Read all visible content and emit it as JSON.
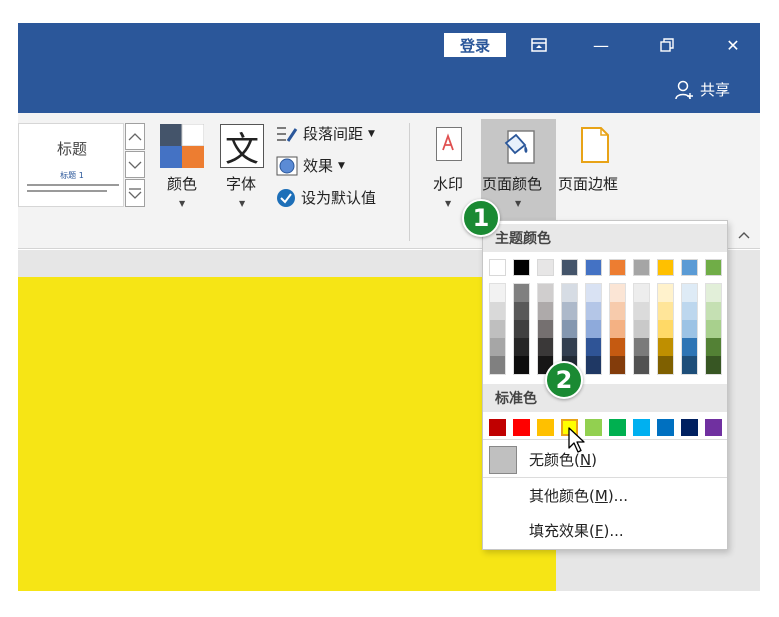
{
  "titlebar": {
    "login_label": "登录",
    "ribbon_display_icon": "ribbon-display-icon",
    "minimize_glyph": "—",
    "restore_glyph": "⧉",
    "close_glyph": "✕",
    "share_label": "共享",
    "bg_color": "#2b579a"
  },
  "ribbon": {
    "gallery": {
      "title": "标题",
      "subtitle": "标题 1"
    },
    "colors_label": "颜色",
    "font_label": "字体",
    "font_glyph": "文",
    "paragraph_spacing_label": "段落间距",
    "effects_label": "效果",
    "set_default_label": "设为默认值",
    "watermark_label": "水印",
    "page_color_label": "页面颜色",
    "page_borders_label": "页面边框",
    "collapse_glyph": "^"
  },
  "document": {
    "page_color": "#f6e515"
  },
  "page_color_menu": {
    "theme_colors_header": "主题颜色",
    "theme_base": [
      "#ffffff",
      "#000000",
      "#e7e6e6",
      "#44546a",
      "#4472c4",
      "#ed7d31",
      "#a5a5a5",
      "#ffc000",
      "#5b9bd5",
      "#70ad47"
    ],
    "theme_shades": [
      [
        "#f2f2f2",
        "#d9d9d9",
        "#bfbfbf",
        "#a6a6a6",
        "#808080"
      ],
      [
        "#808080",
        "#595959",
        "#404040",
        "#262626",
        "#0d0d0d"
      ],
      [
        "#d0cece",
        "#aeaaaa",
        "#757070",
        "#3a3838",
        "#171616"
      ],
      [
        "#d6dce4",
        "#adb9ca",
        "#8497b0",
        "#333f50",
        "#222a35"
      ],
      [
        "#d9e2f3",
        "#b4c6e7",
        "#8eaadb",
        "#2f5496",
        "#1f3864"
      ],
      [
        "#fbe5d5",
        "#f7cbac",
        "#f4b183",
        "#c55a11",
        "#833c0b"
      ],
      [
        "#ededed",
        "#dbdbdb",
        "#c9c9c9",
        "#7b7b7b",
        "#525252"
      ],
      [
        "#fff2cc",
        "#ffe599",
        "#ffd966",
        "#bf8f00",
        "#7f6000"
      ],
      [
        "#deebf6",
        "#bdd7ee",
        "#9cc3e5",
        "#2e75b5",
        "#1e4e79"
      ],
      [
        "#e2efd9",
        "#c5e0b3",
        "#a8d08d",
        "#538135",
        "#375623"
      ]
    ],
    "standard_colors_header": "标准色",
    "standard_colors": [
      "#c00000",
      "#ff0000",
      "#ffc000",
      "#ffff00",
      "#92d050",
      "#00b050",
      "#00b0f0",
      "#0070c0",
      "#002060",
      "#7030a0"
    ],
    "no_color_label": "无颜色",
    "no_color_key": "N",
    "more_colors_label": "其他颜色",
    "more_colors_key": "M",
    "fill_effects_label": "填充效果",
    "fill_effects_key": "F"
  },
  "badges": {
    "step1": "1",
    "step2": "2",
    "badge_color": "#1a8a33"
  }
}
